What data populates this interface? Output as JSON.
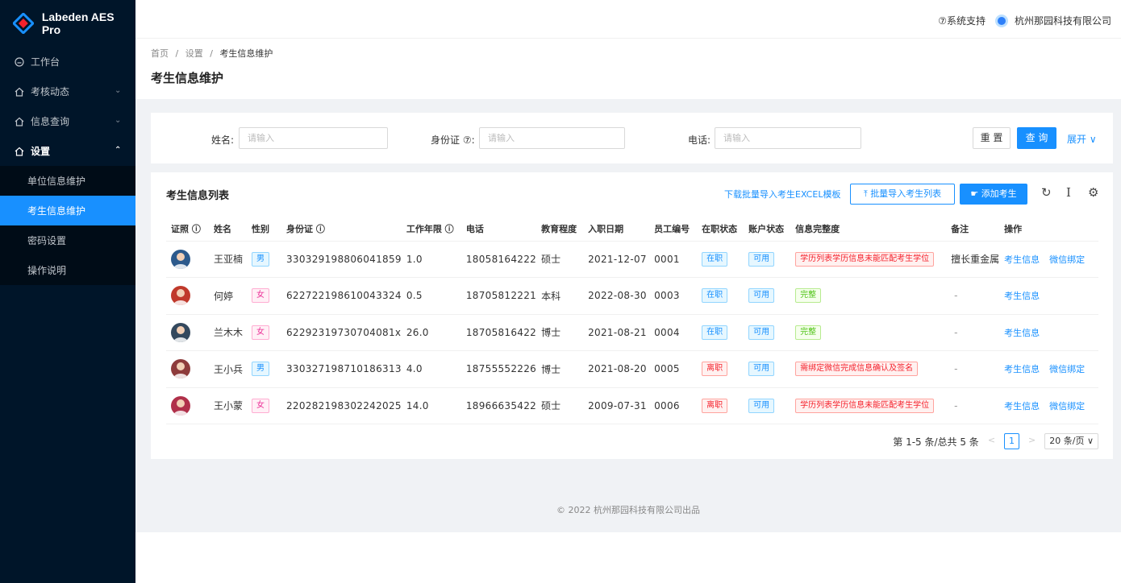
{
  "app": {
    "name": "Labeden AES Pro"
  },
  "sidebar": {
    "items": [
      {
        "label": "工作台"
      },
      {
        "label": "考核动态"
      },
      {
        "label": "信息查询"
      },
      {
        "label": "设置"
      }
    ],
    "submenu": [
      {
        "label": "单位信息维护"
      },
      {
        "label": "考生信息维护"
      },
      {
        "label": "密码设置"
      },
      {
        "label": "操作说明"
      }
    ]
  },
  "header": {
    "support": "⑦系统支持",
    "company": "杭州那园科技有限公司"
  },
  "breadcrumb": {
    "home": "首页",
    "settings": "设置",
    "current": "考生信息维护",
    "sep": "/"
  },
  "page": {
    "title": "考生信息维护"
  },
  "search": {
    "name_label": "姓名:",
    "name_placeholder": "请输入",
    "id_label": "身份证 ⑦:",
    "id_placeholder": "请输入",
    "phone_label": "电话:",
    "phone_placeholder": "请输入",
    "reset": "重 置",
    "query": "查 询",
    "expand": "展开 ∨"
  },
  "table": {
    "title": "考生信息列表",
    "download_template": "下载批量导入考生EXCEL模板",
    "batch_import": "批量导入考生列表",
    "add": "添加考生",
    "columns": [
      "证照 ⓘ",
      "姓名",
      "性别",
      "身份证 ⓘ",
      "工作年限 ⓘ",
      "电话",
      "教育程度",
      "入职日期",
      "员工编号",
      "在职状态",
      "账户状态",
      "信息完整度",
      "备注",
      "操作"
    ],
    "rows": [
      {
        "name": "王亚楠",
        "gender": "男",
        "id": "330329198806041859",
        "years": "1.0",
        "phone": "18058164222",
        "edu": "硕士",
        "date": "2021-12-07",
        "no": "0001",
        "job": "在职",
        "account": "可用",
        "info": "学历列表学历信息未能匹配考生学位",
        "info_type": "red",
        "remark": "擅长重金属",
        "op1": "考生信息",
        "op2": "微信绑定"
      },
      {
        "name": "何婷",
        "gender": "女",
        "id": "622722198610043324",
        "years": "0.5",
        "phone": "18705812221",
        "edu": "本科",
        "date": "2022-08-30",
        "no": "0003",
        "job": "在职",
        "account": "可用",
        "info": "完整",
        "info_type": "green",
        "remark": "-",
        "op1": "考生信息",
        "op2": ""
      },
      {
        "name": "兰木木",
        "gender": "女",
        "id": "62292319730704081x",
        "years": "26.0",
        "phone": "18705816422",
        "edu": "博士",
        "date": "2021-08-21",
        "no": "0004",
        "job": "在职",
        "account": "可用",
        "info": "完整",
        "info_type": "green",
        "remark": "-",
        "op1": "考生信息",
        "op2": ""
      },
      {
        "name": "王小兵",
        "gender": "男",
        "id": "330327198710186313",
        "years": "4.0",
        "phone": "18755552226",
        "edu": "博士",
        "date": "2021-08-20",
        "no": "0005",
        "job": "离职",
        "account": "可用",
        "info": "需绑定微信完成信息确认及签名",
        "info_type": "red",
        "remark": "-",
        "op1": "考生信息",
        "op2": "微信绑定"
      },
      {
        "name": "王小蒙",
        "gender": "女",
        "id": "220282198302242025",
        "years": "14.0",
        "phone": "18966635422",
        "edu": "硕士",
        "date": "2009-07-31",
        "no": "0006",
        "job": "离职",
        "account": "可用",
        "info": "学历列表学历信息未能匹配考生学位",
        "info_type": "red",
        "remark": "-",
        "op1": "考生信息",
        "op2": "微信绑定"
      }
    ]
  },
  "pagination": {
    "summary": "第 1-5 条/总共 5 条",
    "prev": "<",
    "current": "1",
    "next": ">",
    "page_size": "20 条/页 ∨"
  },
  "footer": {
    "text": "© 2022 杭州那园科技有限公司出品"
  }
}
